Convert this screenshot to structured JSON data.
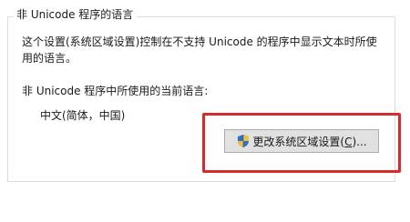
{
  "group": {
    "title": "非 Unicode 程序的语言"
  },
  "description": "这个设置(系统区域设置)控制在不支持 Unicode 的程序中显示文本时所使用的语言。",
  "current_language": {
    "label": "非 Unicode 程序中所使用的当前语言:",
    "value": "中文(简体，中国)"
  },
  "change_button": {
    "label_prefix": "更改系统区域设置(",
    "accelerator": "C",
    "label_suffix": ")...",
    "icon": "uac-shield-icon"
  },
  "highlight_color": "#d62b2b"
}
